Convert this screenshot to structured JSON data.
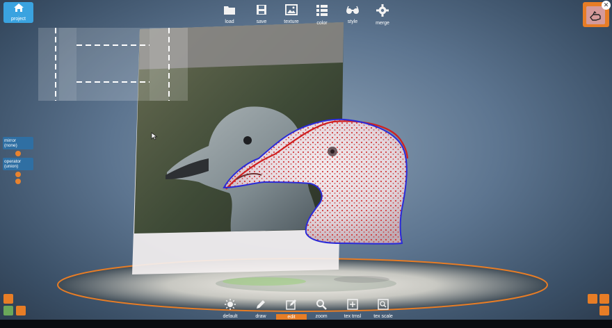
{
  "topbar": {
    "project": {
      "label": "project",
      "icon": "home-icon"
    },
    "tools": [
      {
        "id": "load",
        "label": "load",
        "icon": "folder-icon"
      },
      {
        "id": "save",
        "label": "save",
        "icon": "save-icon"
      },
      {
        "id": "texture",
        "label": "texture",
        "icon": "image-icon"
      },
      {
        "id": "color",
        "label": "color",
        "icon": "list-icon"
      },
      {
        "id": "style",
        "label": "style",
        "icon": "glasses-icon"
      },
      {
        "id": "merge",
        "label": "merge",
        "icon": "gear-icon"
      }
    ],
    "hand_button": {
      "icon": "hand-icon",
      "close_icon": "close-icon"
    }
  },
  "side": {
    "mirror": {
      "label": "mirror\n(none)"
    },
    "operator": {
      "label": "operator\n(union)"
    }
  },
  "bottombar": {
    "tools": [
      {
        "id": "default",
        "label": "default",
        "icon": "sun-icon"
      },
      {
        "id": "draw",
        "label": "draw",
        "icon": "pencil-icon"
      },
      {
        "id": "edit",
        "label": "edit",
        "icon": "edit-icon",
        "active": true
      },
      {
        "id": "zoom",
        "label": "zoom",
        "icon": "zoom-icon"
      },
      {
        "id": "textrnsl",
        "label": "tex trnsl",
        "icon": "plus-box-icon"
      },
      {
        "id": "texscale",
        "label": "tex scale",
        "icon": "zoom-box-icon"
      }
    ]
  },
  "colors": {
    "accent": "#e77d26",
    "project_blue": "#3aa3e0",
    "stroke_blue": "#2a2ad8",
    "stroke_red": "#d02020",
    "ring": "#e77d26"
  }
}
